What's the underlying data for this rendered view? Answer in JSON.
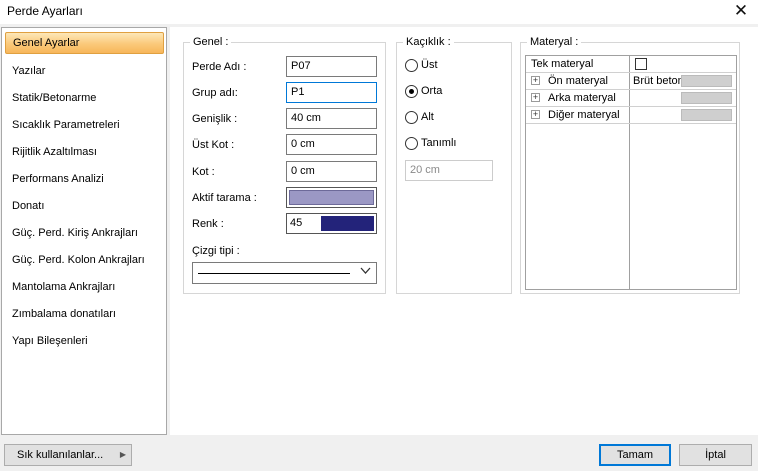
{
  "window": {
    "title": "Perde Ayarları"
  },
  "sidebar": {
    "items": [
      {
        "label": "Genel Ayarlar"
      },
      {
        "label": "Yazılar"
      },
      {
        "label": "Statik/Betonarme"
      },
      {
        "label": "Sıcaklık Parametreleri"
      },
      {
        "label": "Rijitlik Azaltılması"
      },
      {
        "label": "Performans Analizi"
      },
      {
        "label": "Donatı"
      },
      {
        "label": "Güç. Perd. Kiriş Ankrajları"
      },
      {
        "label": "Güç. Perd. Kolon Ankrajları"
      },
      {
        "label": "Mantolama Ankrajları"
      },
      {
        "label": "Zımbalama donatıları"
      },
      {
        "label": "Yapı Bileşenleri"
      }
    ]
  },
  "genel": {
    "title": "Genel :",
    "perde_adi": {
      "label": "Perde Adı :",
      "value": "P07"
    },
    "grup_adi": {
      "label": "Grup adı:",
      "value": "P1"
    },
    "genislik": {
      "label": "Genişlik :",
      "value": "40 cm"
    },
    "ust_kot": {
      "label": "Üst Kot :",
      "value": "0 cm"
    },
    "kot": {
      "label": "Kot :",
      "value": "0 cm"
    },
    "aktif_tarama": {
      "label": "Aktif tarama :"
    },
    "renk": {
      "label": "Renk :",
      "value": "45",
      "color": "#23237a"
    },
    "cizgi_tipi": {
      "label": "Çizgi tipi :"
    }
  },
  "kaciklik": {
    "title": "Kaçıklık :",
    "options": [
      {
        "label": "Üst",
        "selected": false
      },
      {
        "label": "Orta",
        "selected": true
      },
      {
        "label": "Alt",
        "selected": false
      },
      {
        "label": "Tanımlı",
        "selected": false
      }
    ],
    "value": "20 cm"
  },
  "materyal": {
    "title": "Materyal :",
    "tek_materyal": {
      "label": "Tek materyal",
      "checked": false
    },
    "rows": [
      {
        "label": "Ön materyal",
        "value": "Brüt beton"
      },
      {
        "label": "Arka materyal",
        "value": ""
      },
      {
        "label": "Diğer materyal",
        "value": ""
      }
    ]
  },
  "footer": {
    "favorites_label": "Sık kullanılanlar...",
    "ok_label": "Tamam",
    "cancel_label": "İptal"
  },
  "colors": {
    "accent": "#0078d7",
    "highlight": "#fbc97a"
  }
}
